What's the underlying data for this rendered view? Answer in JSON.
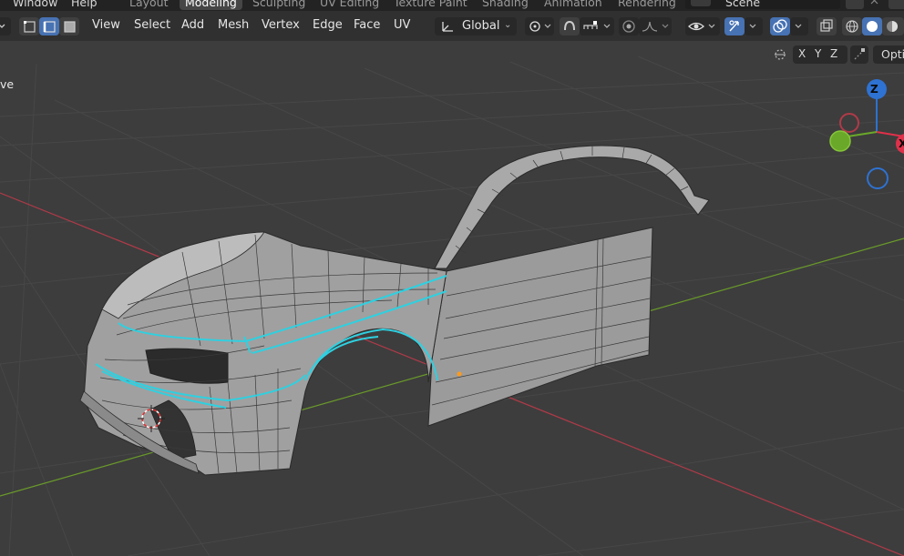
{
  "topbar": {
    "menus": [
      "Window",
      "Help"
    ],
    "workspace_tabs": [
      "Layout",
      "Modeling",
      "Sculpting",
      "UV Editing",
      "Texture Paint",
      "Shading",
      "Animation",
      "Rendering"
    ],
    "active_tab": "Modeling",
    "scene_name": "Scene"
  },
  "header": {
    "menus": [
      "View",
      "Select",
      "Add",
      "Mesh",
      "Vertex",
      "Edge",
      "Face",
      "UV"
    ],
    "transform_orientation": "Global"
  },
  "viewport": {
    "mode_label": "ve",
    "axis_toggles": [
      "X",
      "Y",
      "Z"
    ],
    "options_label": "Opti",
    "gizmo": {
      "z_label": "Z",
      "x_label": "X"
    }
  },
  "colors": {
    "ui_background": "#303030",
    "viewport_background": "#3d3d3d",
    "active_blue": "#4772b3",
    "seam_cyan": "#2fd0e0",
    "x_axis_red": "#b03a48",
    "y_axis_green": "#6a9a2a",
    "gizmo_z": "#2e72d2",
    "gizmo_x": "#e0304a",
    "gizmo_y": "#6aa82a"
  }
}
